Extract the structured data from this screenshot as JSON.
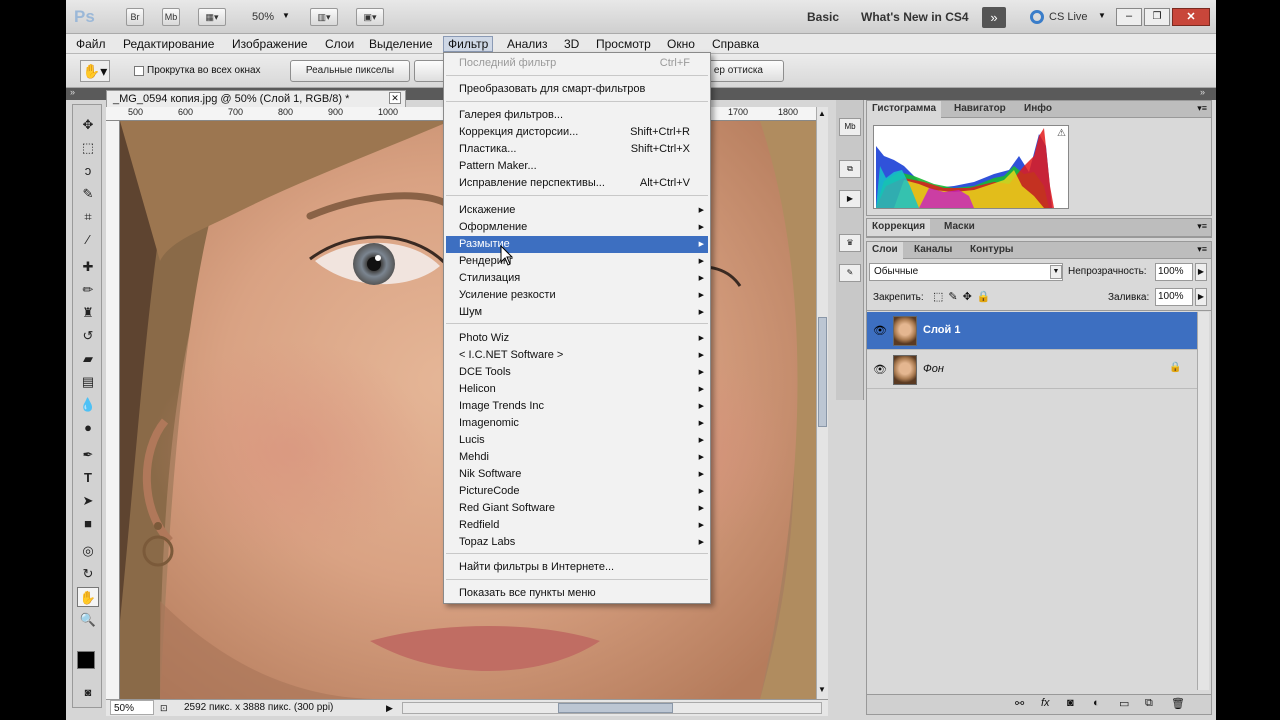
{
  "appbar": {
    "logo": "Ps",
    "br": "Br",
    "mb": "Mb",
    "zoom": "50%",
    "workspace": "Basic",
    "whats_new": "What's New in CS4",
    "cs_live": "CS Live"
  },
  "menu": [
    "Файл",
    "Редактирование",
    "Изображение",
    "Слои",
    "Выделение",
    "Фильтр",
    "Анализ",
    "3D",
    "Просмотр",
    "Окно",
    "Справка"
  ],
  "options": {
    "scroll_all": "Прокрутка во всех окнах",
    "actual_pixels": "Реальные пикселы",
    "print_size": "ер оттиска"
  },
  "document": {
    "tab": "_MG_0594 копия.jpg @ 50% (Слой 1, RGB/8) *",
    "ruler_labels": [
      "500",
      "600",
      "700",
      "800",
      "900",
      "1000",
      "1700",
      "1800"
    ],
    "zoom": "50%",
    "info": "2592 пикс. x 3888 пикс. (300 ppi)"
  },
  "filter_menu": {
    "last_filter": "Последний фильтр",
    "last_filter_sc": "Ctrl+F",
    "smart": "Преобразовать для смарт-фильтров",
    "gallery": "Галерея фильтров...",
    "lens": "Коррекция дисторсии...",
    "lens_sc": "Shift+Ctrl+R",
    "liquify": "Пластика...",
    "liquify_sc": "Shift+Ctrl+X",
    "pattern": "Pattern Maker...",
    "vanish": "Исправление перспективы...",
    "vanish_sc": "Alt+Ctrl+V",
    "sub1": [
      "Искажение",
      "Оформление",
      "Размытие",
      "Рендеринг",
      "Стилизация",
      "Усиление резкости",
      "Шум"
    ],
    "plugins": [
      "Photo Wiz",
      "< I.C.NET Software >",
      "DCE Tools",
      "Helicon",
      "Image Trends Inc",
      "Imagenomic",
      "Lucis",
      "Mehdi",
      "Nik Software",
      "PictureCode",
      "Red Giant Software",
      "Redfield",
      "Topaz Labs"
    ],
    "browse": "Найти фильтры в Интернете...",
    "show_all": "Показать все пункты меню"
  },
  "panels": {
    "hist_tabs": [
      "Гистограмма",
      "Навигатор",
      "Инфо"
    ],
    "adj_tabs": [
      "Коррекция",
      "Маски"
    ],
    "layer_tabs": [
      "Слои",
      "Каналы",
      "Контуры"
    ],
    "blend": "Обычные",
    "opacity_label": "Непрозрачность:",
    "opacity": "100%",
    "lock_label": "Закрепить:",
    "fill_label": "Заливка:",
    "fill": "100%",
    "layers": [
      "Слой 1",
      "Фон"
    ]
  }
}
